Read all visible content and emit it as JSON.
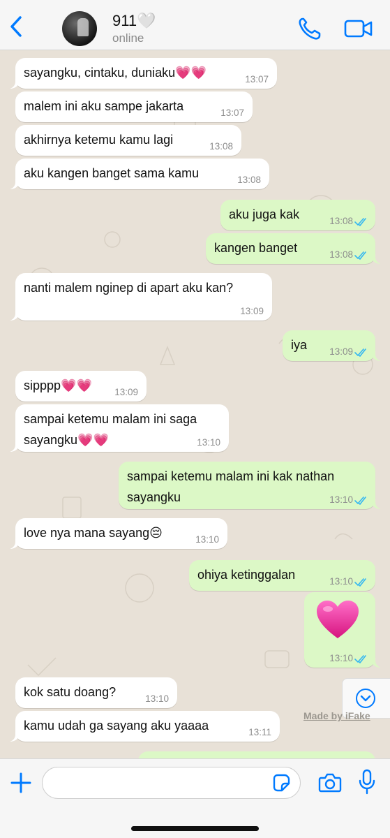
{
  "header": {
    "contact_name": "911🤍",
    "status": "online"
  },
  "messages": [
    {
      "direction": "in",
      "text": "sayangku, cintaku, duniaku💗💗",
      "time": "13:07"
    },
    {
      "direction": "in",
      "text": "malem ini aku sampe jakarta",
      "time": "13:07"
    },
    {
      "direction": "in",
      "text": "akhirnya ketemu kamu lagi",
      "time": "13:08"
    },
    {
      "direction": "in",
      "text": "aku kangen banget sama kamu",
      "time": "13:08"
    },
    {
      "direction": "out",
      "text": "aku juga kak",
      "time": "13:08",
      "read": true
    },
    {
      "direction": "out",
      "text": "kangen banget",
      "time": "13:08",
      "read": true
    },
    {
      "direction": "in",
      "text": "nanti malem nginep di apart aku kan?",
      "time": "13:09"
    },
    {
      "direction": "out",
      "text": "iya",
      "time": "13:09",
      "read": true
    },
    {
      "direction": "in",
      "text": "sipppp💗💗",
      "time": "13:09"
    },
    {
      "direction": "in",
      "text": "sampai ketemu malam ini saga sayangku💗💗",
      "time": "13:10"
    },
    {
      "direction": "out",
      "text": "sampai ketemu malam ini kak nathan sayangku",
      "time": "13:10",
      "read": true
    },
    {
      "direction": "in",
      "text": "love nya mana sayang😔",
      "time": "13:10"
    },
    {
      "direction": "out",
      "text": "ohiya ketinggalan",
      "time": "13:10",
      "read": true
    },
    {
      "direction": "out",
      "text": "💗",
      "time": "13:10",
      "read": true,
      "emoji_only": true
    },
    {
      "direction": "in",
      "text": "kok satu doang?",
      "time": "13:10"
    },
    {
      "direction": "in",
      "text": "kamu udah ga sayang aku yaaaa",
      "time": "13:11"
    }
  ],
  "watermark": "Made by iFake",
  "composer": {
    "placeholder": ""
  },
  "colors": {
    "accent": "#007aff",
    "incoming_bubble": "#ffffff",
    "outgoing_bubble": "#dcf8c6",
    "read_ticks": "#34b7f1",
    "chat_background": "#e8e1d7"
  },
  "icons": {
    "back": "chevron-left-icon",
    "call": "phone-icon",
    "video": "video-camera-icon",
    "scroll": "chevron-down-circle-icon",
    "plus": "plus-icon",
    "sticker": "sticker-icon",
    "camera": "camera-icon",
    "mic": "microphone-icon"
  }
}
